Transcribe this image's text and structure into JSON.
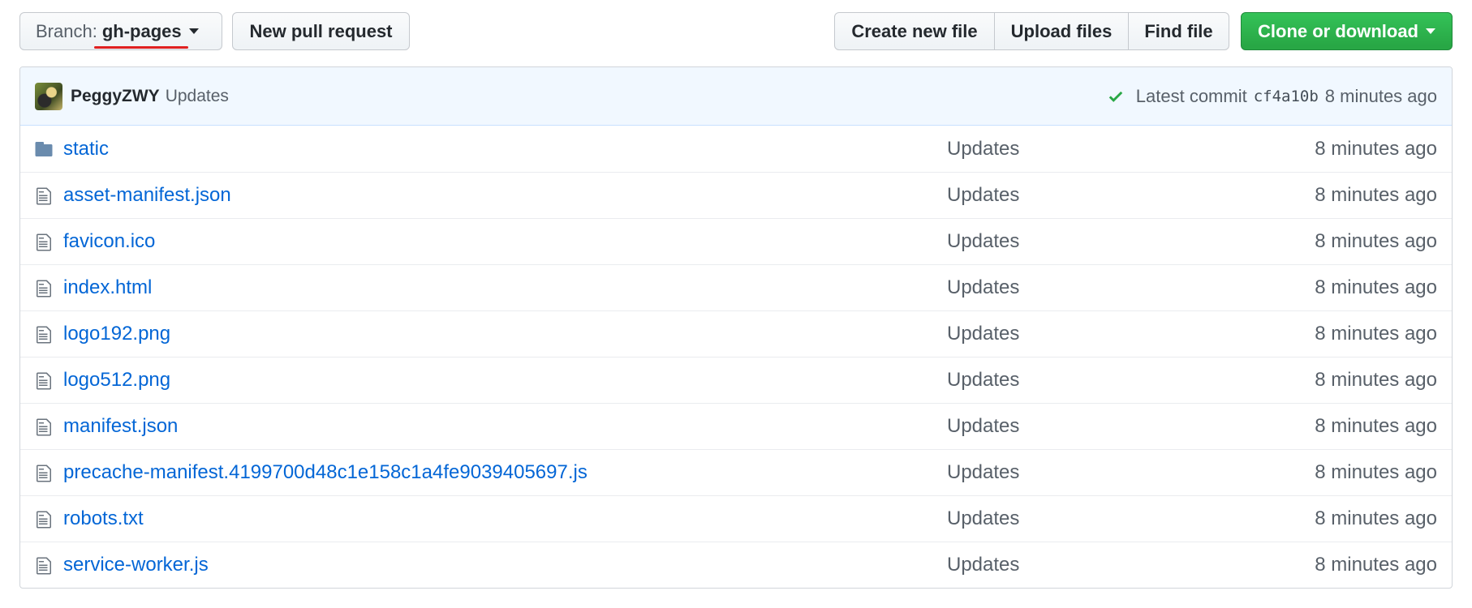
{
  "toolbar": {
    "branch_prefix": "Branch:",
    "branch_name": "gh-pages",
    "new_pull_request": "New pull request",
    "create_new_file": "Create new file",
    "upload_files": "Upload files",
    "find_file": "Find file",
    "clone_or_download": "Clone or download"
  },
  "commit": {
    "author": "PeggyZWY",
    "message": "Updates",
    "latest_label": "Latest commit",
    "sha": "cf4a10b",
    "age": "8 minutes ago",
    "status_color": "#28a745"
  },
  "files": [
    {
      "name": "static",
      "type": "folder",
      "commit": "Updates",
      "age": "8 minutes ago"
    },
    {
      "name": "asset-manifest.json",
      "type": "file",
      "commit": "Updates",
      "age": "8 minutes ago"
    },
    {
      "name": "favicon.ico",
      "type": "file",
      "commit": "Updates",
      "age": "8 minutes ago"
    },
    {
      "name": "index.html",
      "type": "file",
      "commit": "Updates",
      "age": "8 minutes ago"
    },
    {
      "name": "logo192.png",
      "type": "file",
      "commit": "Updates",
      "age": "8 minutes ago"
    },
    {
      "name": "logo512.png",
      "type": "file",
      "commit": "Updates",
      "age": "8 minutes ago"
    },
    {
      "name": "manifest.json",
      "type": "file",
      "commit": "Updates",
      "age": "8 minutes ago"
    },
    {
      "name": "precache-manifest.4199700d48c1e158c1a4fe9039405697.js",
      "type": "file",
      "commit": "Updates",
      "age": "8 minutes ago"
    },
    {
      "name": "robots.txt",
      "type": "file",
      "commit": "Updates",
      "age": "8 minutes ago"
    },
    {
      "name": "service-worker.js",
      "type": "file",
      "commit": "Updates",
      "age": "8 minutes ago"
    }
  ],
  "colors": {
    "link": "#0366d6",
    "primary_button": "#28a745",
    "annotation_underline": "#e02020"
  }
}
